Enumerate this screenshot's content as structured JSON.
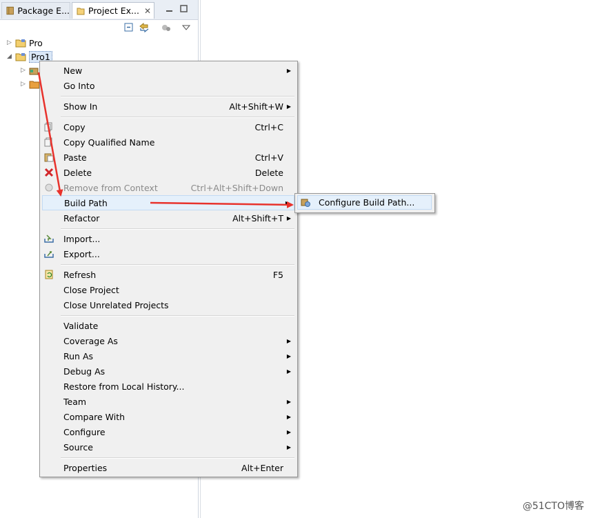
{
  "tabs": [
    {
      "label": "Package E...",
      "icon": "package-explorer-icon"
    },
    {
      "label": "Project Ex...",
      "icon": "project-explorer-icon",
      "close": "✕"
    }
  ],
  "tree": [
    {
      "label": "Pro",
      "expanded": false
    },
    {
      "label": "Pro1",
      "expanded": true,
      "selected": true
    }
  ],
  "menu": [
    {
      "label": "New",
      "shortcut": "",
      "submenu": true
    },
    {
      "label": "Go Into",
      "shortcut": ""
    },
    {
      "label": "Show In",
      "shortcut": "Alt+Shift+W",
      "submenu": true
    },
    {
      "label": "Copy",
      "shortcut": "Ctrl+C",
      "icon": "copy-icon"
    },
    {
      "label": "Copy Qualified Name",
      "shortcut": "",
      "icon": "copy-qualified-icon"
    },
    {
      "label": "Paste",
      "shortcut": "Ctrl+V",
      "icon": "paste-icon"
    },
    {
      "label": "Delete",
      "shortcut": "Delete",
      "icon": "delete-icon"
    },
    {
      "label": "Remove from Context",
      "shortcut": "Ctrl+Alt+Shift+Down",
      "disabled": true,
      "icon": "remove-context-icon"
    },
    {
      "label": "Build Path",
      "shortcut": "",
      "submenu": true,
      "highlighted": true
    },
    {
      "label": "Refactor",
      "shortcut": "Alt+Shift+T",
      "submenu": true
    },
    {
      "label": "Import...",
      "shortcut": "",
      "icon": "import-icon"
    },
    {
      "label": "Export...",
      "shortcut": "",
      "icon": "export-icon"
    },
    {
      "label": "Refresh",
      "shortcut": "F5",
      "icon": "refresh-icon"
    },
    {
      "label": "Close Project",
      "shortcut": ""
    },
    {
      "label": "Close Unrelated Projects",
      "shortcut": ""
    },
    {
      "label": "Validate",
      "shortcut": ""
    },
    {
      "label": "Coverage As",
      "shortcut": "",
      "submenu": true
    },
    {
      "label": "Run As",
      "shortcut": "",
      "submenu": true
    },
    {
      "label": "Debug As",
      "shortcut": "",
      "submenu": true
    },
    {
      "label": "Restore from Local History...",
      "shortcut": ""
    },
    {
      "label": "Team",
      "shortcut": "",
      "submenu": true
    },
    {
      "label": "Compare With",
      "shortcut": "",
      "submenu": true
    },
    {
      "label": "Configure",
      "shortcut": "",
      "submenu": true
    },
    {
      "label": "Source",
      "shortcut": "",
      "submenu": true
    },
    {
      "label": "Properties",
      "shortcut": "Alt+Enter"
    }
  ],
  "submenu": {
    "label": "Configure Build Path...",
    "icon": "configure-build-path-icon"
  },
  "watermark": "@51CTO博客",
  "colors": {
    "annotation_arrow": "#e8322c",
    "highlight": "#e5f0fb",
    "menu_bg": "#f0f0f0"
  }
}
